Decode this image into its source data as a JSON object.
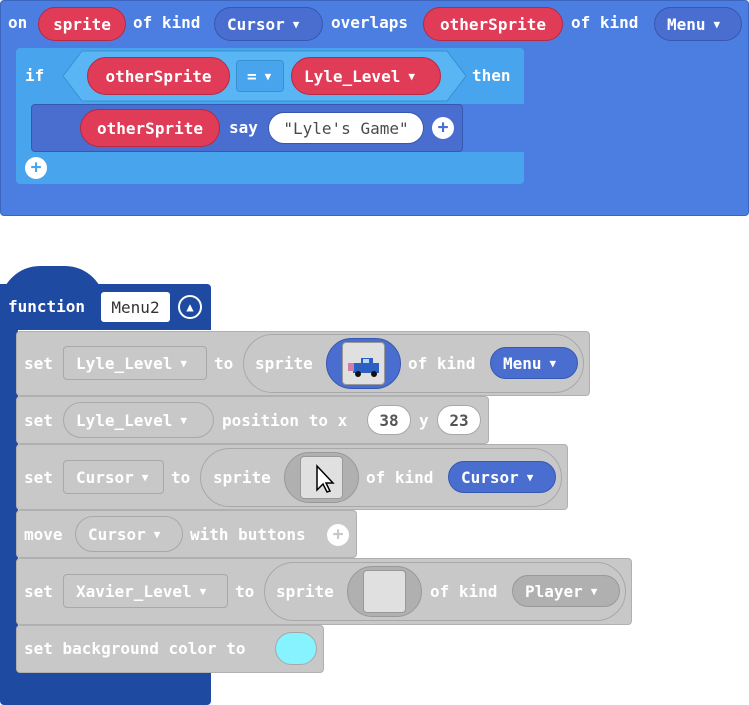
{
  "event": {
    "on": "on",
    "sprite_var": "sprite",
    "of_kind_1": "of kind",
    "kind_1": "Cursor",
    "overlaps": "overlaps",
    "other_var": "otherSprite",
    "of_kind_2": "of kind",
    "kind_2": "Menu"
  },
  "if_block": {
    "if": "if",
    "left": "otherSprite",
    "op": "=",
    "right": "Lyle_Level",
    "then": "then"
  },
  "say_block": {
    "target": "otherSprite",
    "say": "say",
    "text": "\"Lyle's Game\""
  },
  "function_block": {
    "keyword": "function",
    "name": "Menu2",
    "statements": [
      {
        "set": "set",
        "var": "Lyle_Level",
        "to": "to",
        "sprite": "sprite",
        "of_kind": "of kind",
        "kind": "Menu"
      },
      {
        "set": "set",
        "var": "Lyle_Level",
        "position": "position to x",
        "x": "38",
        "y_label": "y",
        "y": "23"
      },
      {
        "set": "set",
        "var": "Cursor",
        "to": "to",
        "sprite": "sprite",
        "of_kind": "of kind",
        "kind": "Cursor"
      },
      {
        "move": "move",
        "var": "Cursor",
        "with": "with buttons"
      },
      {
        "set": "set",
        "var": "Xavier_Level",
        "to": "to",
        "sprite": "sprite",
        "of_kind": "of kind",
        "kind": "Player"
      },
      {
        "label": "set background color to",
        "color": "#86f3ff"
      }
    ]
  },
  "colors": {
    "event_blue": "#4c7de0",
    "logic_blue": "#48a4ec",
    "variable_red": "#e03b57",
    "sprite_blue": "#4a6ed0",
    "function_navy": "#1e4aa2",
    "gray_block": "#c8c8c8",
    "bg_color_swatch": "#86f3ff"
  }
}
